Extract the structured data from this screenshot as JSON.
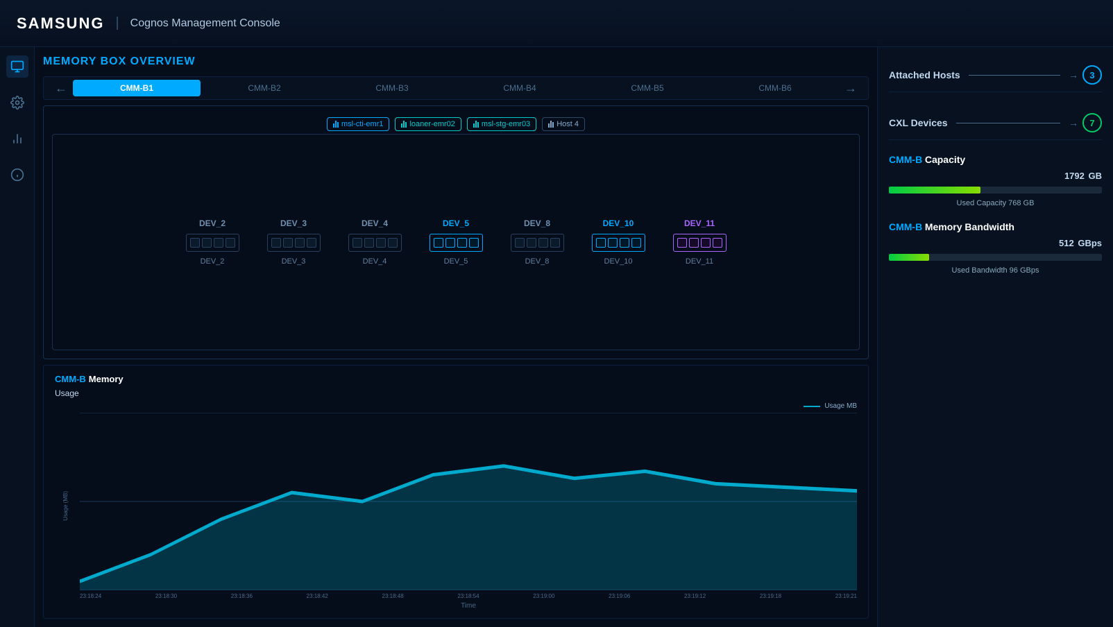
{
  "header": {
    "logo": "SAMSUNG",
    "divider": "|",
    "app_title": "Cognos Management Console"
  },
  "page": {
    "title": "MEMORY BOX OVERVIEW"
  },
  "sidebar": {
    "items": [
      {
        "name": "monitor",
        "icon": "monitor",
        "active": true
      },
      {
        "name": "settings",
        "icon": "gear",
        "active": false
      },
      {
        "name": "chart",
        "icon": "chart",
        "active": false
      },
      {
        "name": "info",
        "icon": "info",
        "active": false
      }
    ]
  },
  "cmm_nav": {
    "tabs": [
      "CMM-B1",
      "CMM-B2",
      "CMM-B3",
      "CMM-B4",
      "CMM-B5",
      "CMM-B6"
    ],
    "active": "CMM-B1"
  },
  "hosts": [
    {
      "label": "msl-cti-emr1",
      "type": "blue"
    },
    {
      "label": "loaner-emr02",
      "type": "cyan"
    },
    {
      "label": "msl-stg-emr03",
      "type": "cyan"
    },
    {
      "label": "Host 4",
      "type": "default"
    }
  ],
  "devices": [
    {
      "id": "DEV_2",
      "label_top": "DEV_2",
      "label_bottom": "DEV_2",
      "style": "default"
    },
    {
      "id": "DEV_3",
      "label_top": "DEV_3",
      "label_bottom": "DEV_3",
      "style": "default"
    },
    {
      "id": "DEV_4",
      "label_top": "DEV_4",
      "label_bottom": "DEV_4",
      "style": "default"
    },
    {
      "id": "DEV_5",
      "label_top": "DEV_5",
      "label_bottom": "DEV_5",
      "style": "blue"
    },
    {
      "id": "DEV_8",
      "label_top": "DEV_8",
      "label_bottom": "DEV_8",
      "style": "default"
    },
    {
      "id": "DEV_10",
      "label_top": "DEV_10",
      "label_bottom": "DEV_10",
      "style": "blue"
    },
    {
      "id": "DEV_11",
      "label_top": "DEV_11",
      "label_bottom": "DEV_11",
      "style": "purple"
    }
  ],
  "right_panel": {
    "attached_hosts": {
      "label": "Attached Hosts",
      "value": "3",
      "badge_color": "blue"
    },
    "cxl_devices": {
      "label": "CXL Devices",
      "value": "7",
      "badge_color": "green"
    },
    "capacity": {
      "title_blue": "CMM-B",
      "title_white": " Capacity",
      "total": "1792",
      "total_unit": "GB",
      "used": "768",
      "used_label": "Used Capacity 768 GB",
      "fill_percent": 43
    },
    "bandwidth": {
      "title_blue": "CMM-B",
      "title_white": " Memory ",
      "title_white2": "Bandwidth",
      "total": "512",
      "total_unit": "GBps",
      "used": "96",
      "used_label": "Used Bandwidth 96 GBps",
      "fill_percent": 19
    }
  },
  "chart": {
    "title_blue": "CMM-B",
    "title_white": " Memory",
    "subtitle": "Usage",
    "y_label": "Usage (MB)",
    "x_label": "Time",
    "legend_label": "Usage MB",
    "y_max": "500,000",
    "y_min": "0",
    "x_labels": [
      "23:18:24",
      "23:18:30",
      "23:18:36",
      "23:18:42",
      "23:18:48",
      "23:18:54",
      "23:19:00",
      "23:19:06",
      "23:19:12",
      "23:19:18",
      "23:19:21"
    ],
    "data_points": [
      5,
      25,
      45,
      60,
      55,
      70,
      75,
      68,
      72,
      65,
      62
    ]
  }
}
